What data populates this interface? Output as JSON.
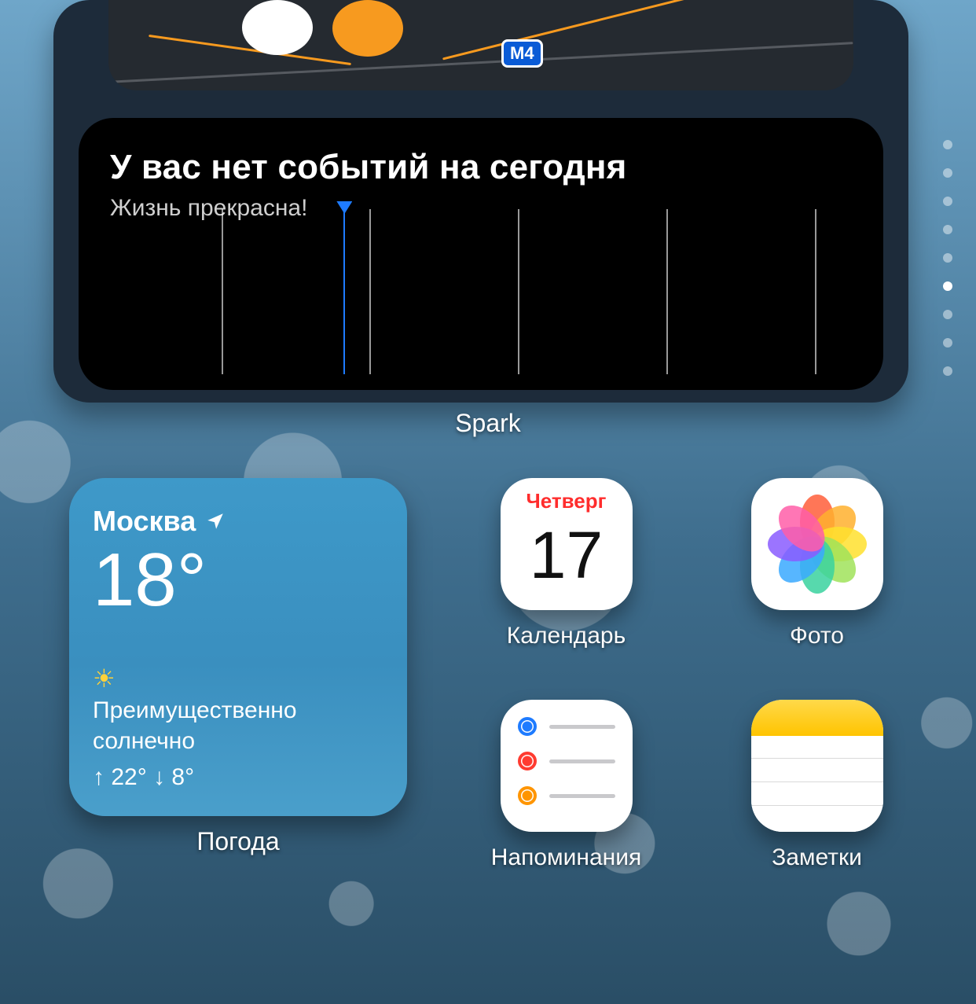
{
  "spark": {
    "title": "У вас нет событий на сегодня",
    "subtitle": "Жизнь прекрасна!",
    "label": "Spark",
    "map_badge": "M4"
  },
  "page_indicator": {
    "count": 9,
    "active_index": 5
  },
  "weather": {
    "city": "Москва",
    "temp": "18°",
    "condition": "Преимущественно солнечно",
    "high": "22°",
    "low": "8°",
    "label": "Погода"
  },
  "apps": {
    "calendar": {
      "weekday": "Четверг",
      "day": "17",
      "label": "Календарь",
      "weekday_color": "#ff2d2d"
    },
    "photos": {
      "label": "Фото"
    },
    "reminders": {
      "label": "Напоминания"
    },
    "notes": {
      "label": "Заметки"
    }
  },
  "petal_colors": [
    "#ff5e3a",
    "#ffb02e",
    "#ffe02e",
    "#a0e35a",
    "#3ad29f",
    "#3aa9ff",
    "#8a5cff",
    "#ff5ea8"
  ]
}
